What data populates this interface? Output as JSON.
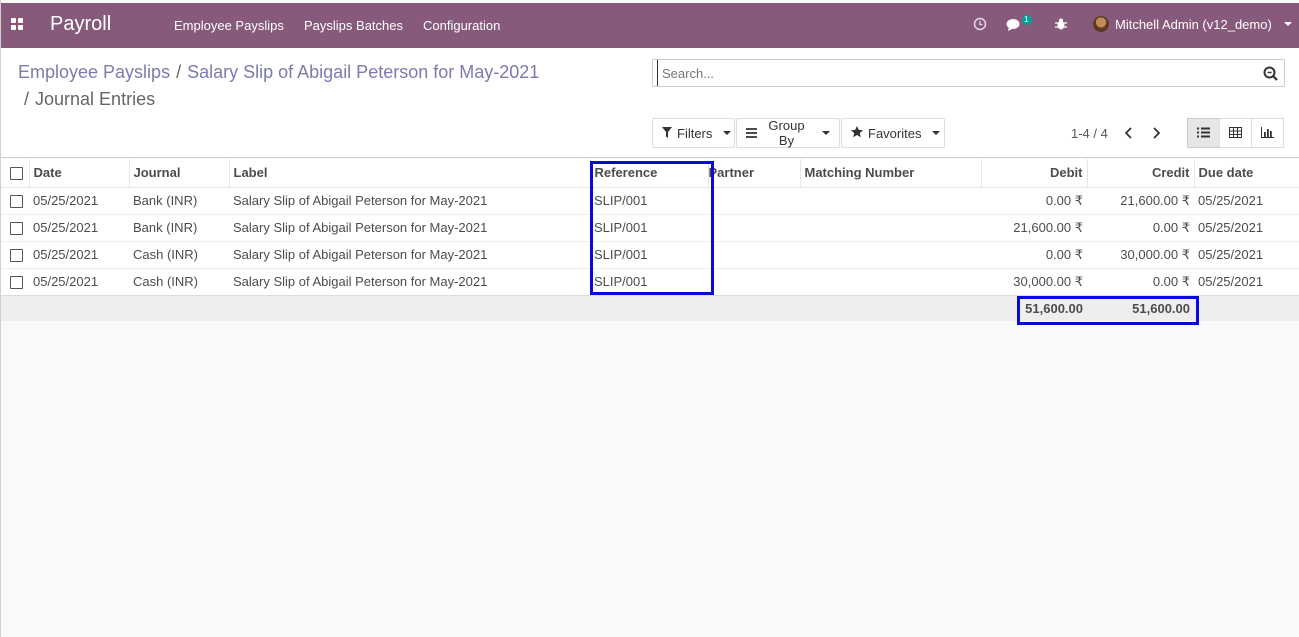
{
  "app": {
    "title": "Payroll"
  },
  "menu": [
    {
      "label": "Employee Payslips"
    },
    {
      "label": "Payslips Batches"
    },
    {
      "label": "Configuration"
    }
  ],
  "systray": {
    "chat_count": "1",
    "user": "Mitchell Admin (v12_demo)"
  },
  "breadcrumb": {
    "first": "Employee Payslips",
    "sep1": "/",
    "second": "Salary Slip of Abigail Peterson for May-2021",
    "sep2": "/",
    "current": "Journal Entries"
  },
  "search": {
    "placeholder": "Search..."
  },
  "buttons": {
    "filters": "Filters",
    "group_by": "Group By",
    "favorites": "Favorites"
  },
  "pager": {
    "text": "1-4 / 4"
  },
  "table": {
    "headers": [
      "Date",
      "Journal",
      "Label",
      "Reference",
      "Partner",
      "Matching Number",
      "Debit",
      "Credit",
      "Due date"
    ],
    "rows": [
      [
        "05/25/2021",
        "Bank (INR)",
        "Salary Slip of Abigail Peterson for May-2021",
        "SLIP/001",
        "",
        "",
        "0.00 ₹",
        "21,600.00 ₹",
        "05/25/2021"
      ],
      [
        "05/25/2021",
        "Bank (INR)",
        "Salary Slip of Abigail Peterson for May-2021",
        "SLIP/001",
        "",
        "",
        "21,600.00 ₹",
        "0.00 ₹",
        "05/25/2021"
      ],
      [
        "05/25/2021",
        "Cash (INR)",
        "Salary Slip of Abigail Peterson for May-2021",
        "SLIP/001",
        "",
        "",
        "0.00 ₹",
        "30,000.00 ₹",
        "05/25/2021"
      ],
      [
        "05/25/2021",
        "Cash (INR)",
        "Salary Slip of Abigail Peterson for May-2021",
        "SLIP/001",
        "",
        "",
        "30,000.00 ₹",
        "0.00 ₹",
        "05/25/2021"
      ]
    ],
    "totals": {
      "debit": "51,600.00",
      "credit": "51,600.00"
    }
  },
  "colors": {
    "brand": "#875a7b",
    "link": "#7c7bad",
    "highlight": "#0a0ad6"
  }
}
